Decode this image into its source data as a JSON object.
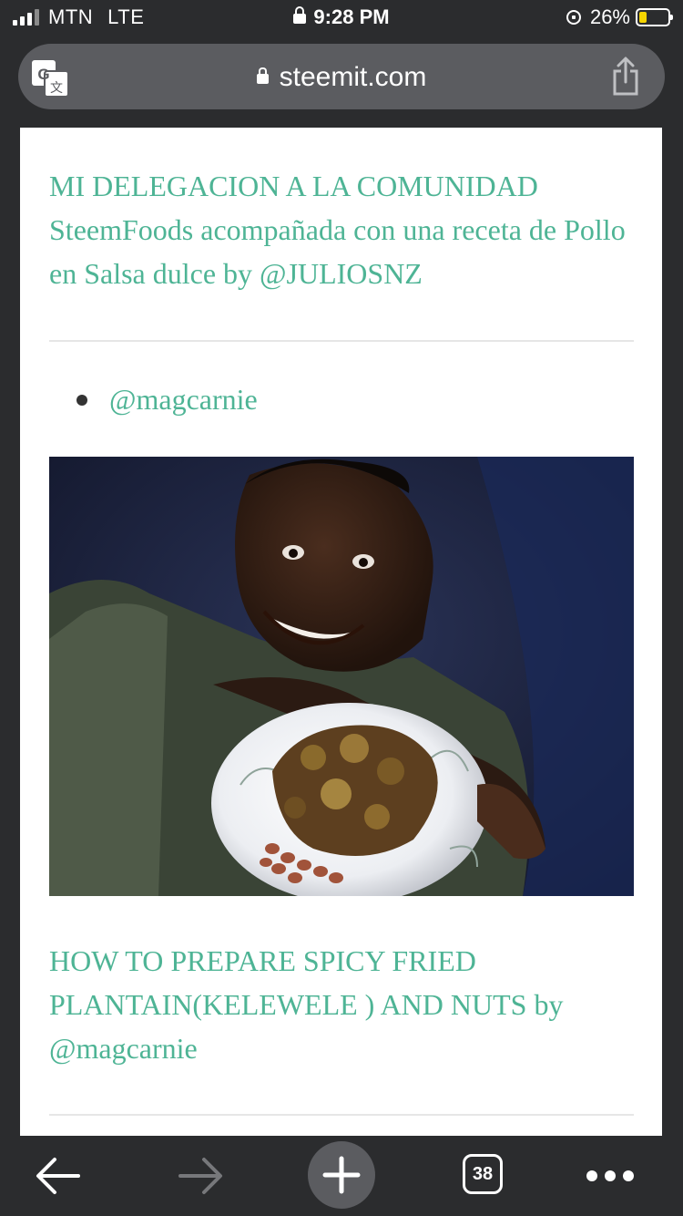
{
  "status_bar": {
    "carrier": "MTN",
    "network": "LTE",
    "time": "9:28 PM",
    "battery_percent": "26%",
    "battery_level": 0.26
  },
  "browser": {
    "url": "steemit.com",
    "tab_count": "38"
  },
  "article": {
    "link_1": "MI DELEGACION A LA COMUNIDAD SteemFoods acompañada con una receta de Pollo en Salsa dulce by @JULIOSNZ",
    "bullet_1": "@magcarnie",
    "link_2": "HOW TO PREPARE SPICY FRIED PLANTAIN(KELEWELE ) AND NUTS by @magcarnie"
  },
  "colors": {
    "link": "#4eb495",
    "chrome_background": "#2b2c2e",
    "url_bar": "#5b5c60",
    "battery_fill": "#f5d400"
  },
  "icons": [
    "translate-icon",
    "lock-icon",
    "share-icon",
    "back-arrow-icon",
    "forward-arrow-icon",
    "plus-icon",
    "tabs-icon",
    "more-icon",
    "orientation-lock-icon",
    "battery-icon",
    "signal-icon"
  ]
}
